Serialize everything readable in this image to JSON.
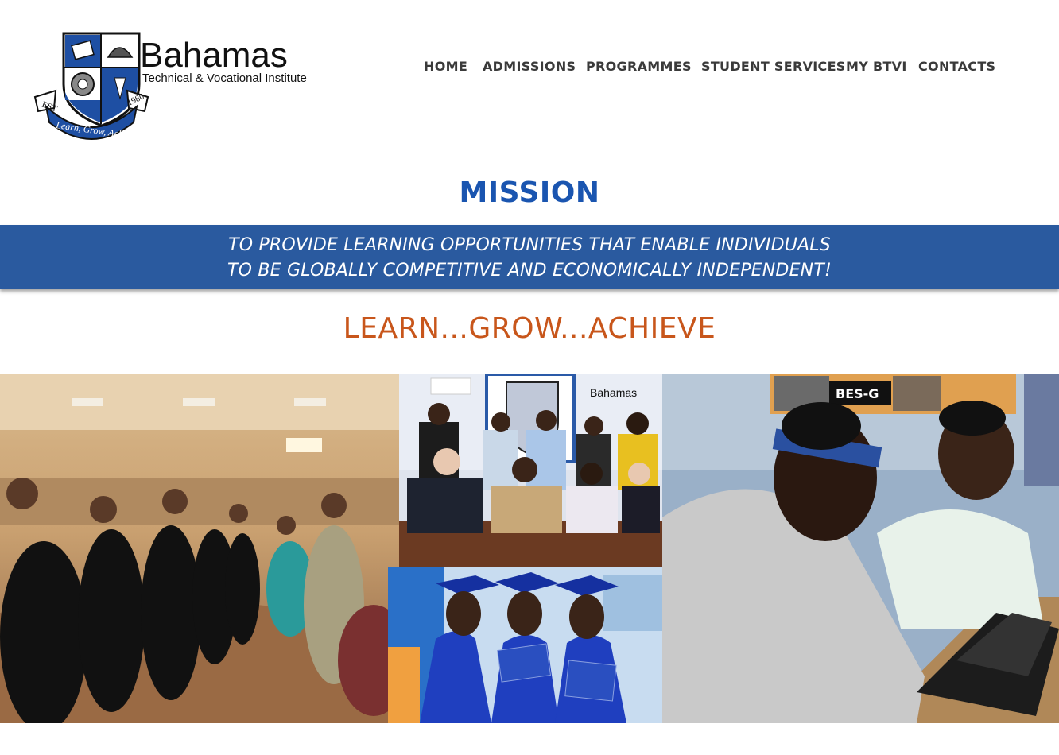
{
  "logo": {
    "name": "Bahamas",
    "subtitle": "Technical & Vocational Institute",
    "motto": "Learn, Grow, Achieve",
    "est_label": "EST",
    "est_year": "1980"
  },
  "nav": {
    "items": [
      {
        "label": "HOME"
      },
      {
        "label": "ADMISSIONS"
      },
      {
        "label": "PROGRAMMES"
      },
      {
        "label": "STUDENT SERVICES"
      },
      {
        "label": "MY BTVI"
      },
      {
        "label": "CONTACTS"
      }
    ]
  },
  "mission": {
    "title": "MISSION",
    "line1": "TO PROVIDE LEARNING OPPORTUNITIES THAT ENABLE INDIVIDUALS",
    "line2": "TO BE GLOBALLY COMPETITIVE AND ECONOMICALLY INDEPENDENT!"
  },
  "tagline": "LEARN...GROW...ACHIEVE",
  "photos": {
    "mini_logo_text": "Bahamas",
    "sign_text": "BES-G"
  },
  "colors": {
    "brand_blue": "#1a55b0",
    "banner_blue": "#2a5a9f",
    "tagline_orange": "#c8561b",
    "nav_text": "#3a3a3a"
  }
}
